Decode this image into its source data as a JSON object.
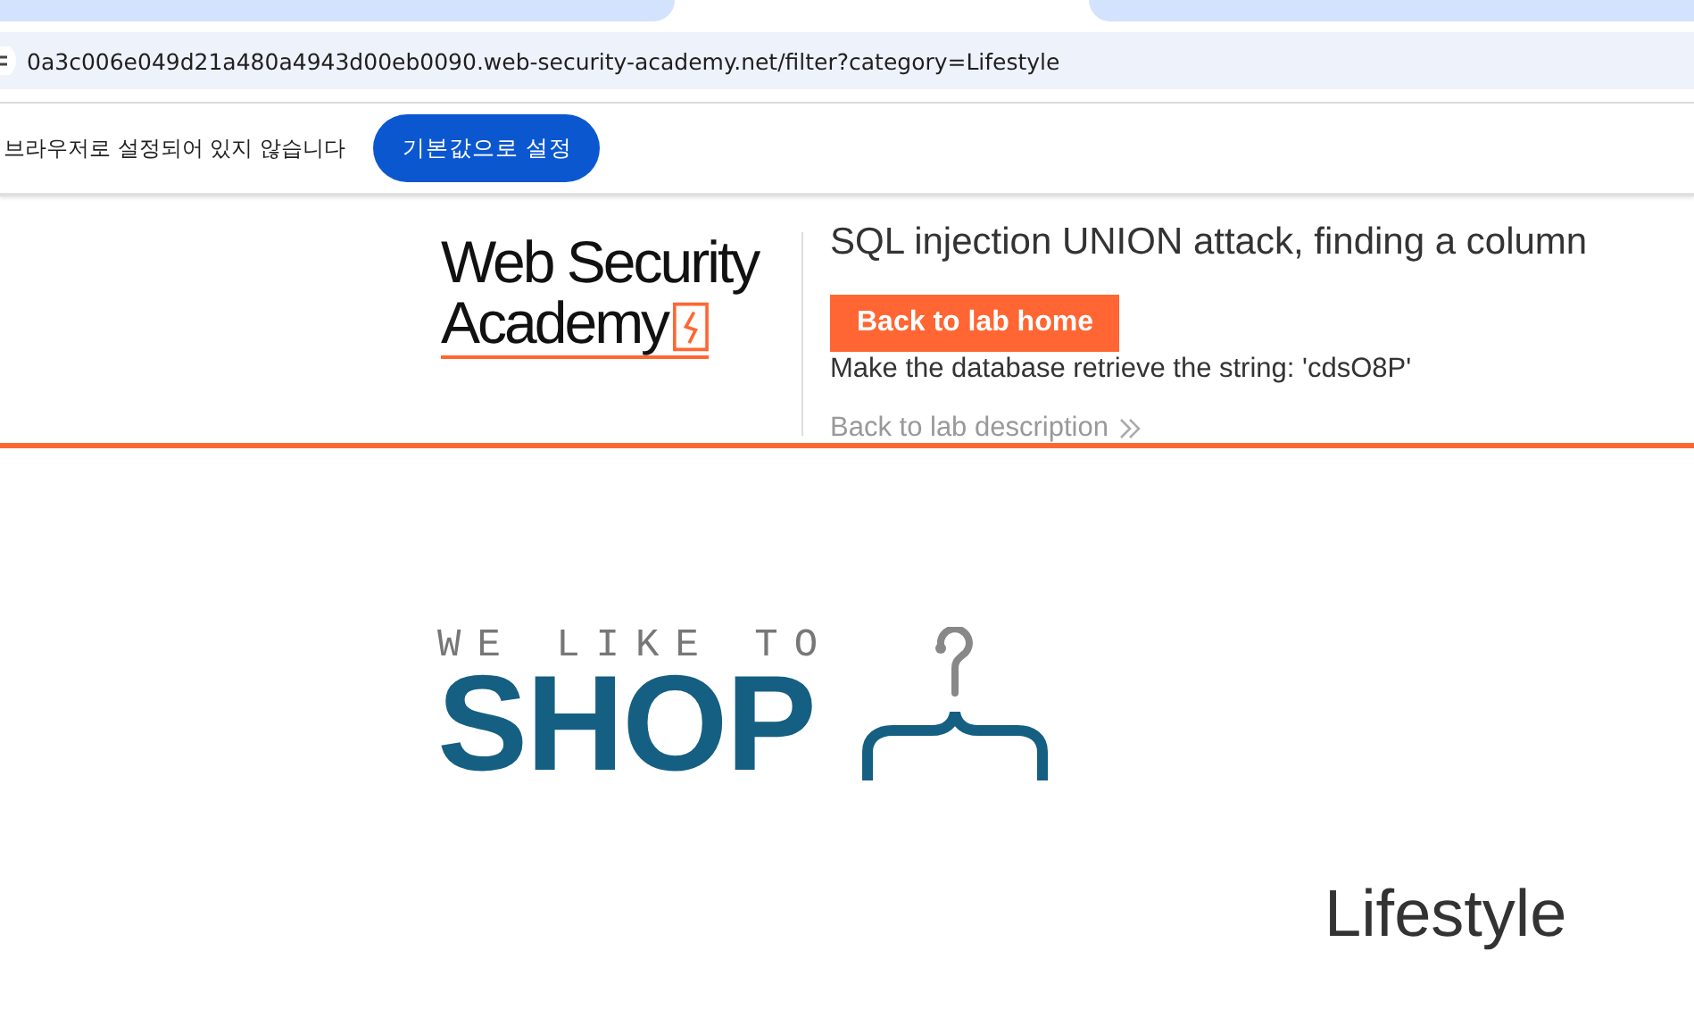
{
  "address_bar": {
    "url": "0a3c006e049d21a480a4943d00eb0090.web-security-academy.net/filter?category=Lifestyle"
  },
  "infobar": {
    "message": "브라우저로 설정되어 있지 않습니다",
    "button": "기본값으로 설정"
  },
  "lab_header": {
    "logo_line_1": "Web Security",
    "logo_line_2": "Academy",
    "title": "SQL injection UNION attack, finding a column",
    "home_button": "Back to lab home",
    "description": "Make the database retrieve the string: 'cdsO8P'",
    "back_link": "Back to lab description"
  },
  "shop_logo": {
    "tagline": "WE LIKE TO",
    "word": "SHOP"
  },
  "heading": "Lifestyle"
}
